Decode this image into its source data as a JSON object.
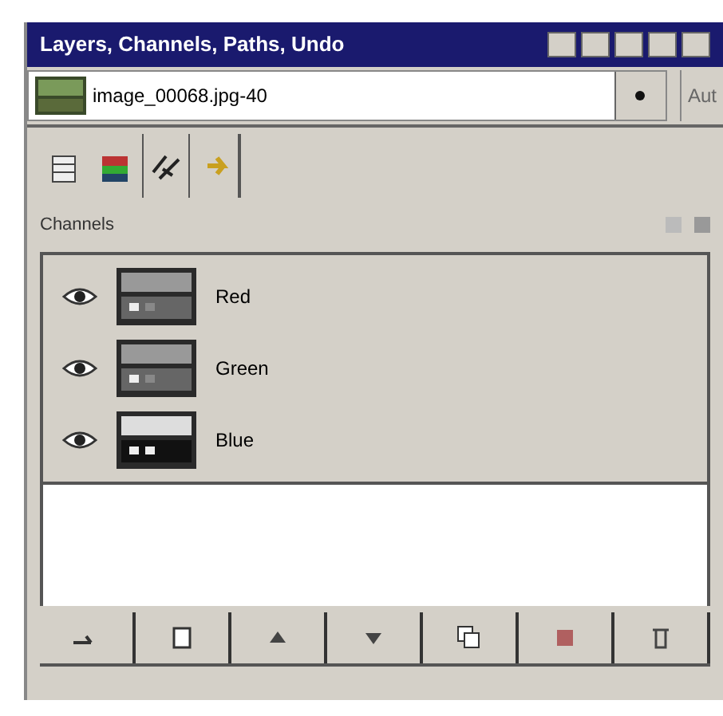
{
  "window": {
    "title": "Layers, Channels, Paths, Undo"
  },
  "image_menu": {
    "value": "image_00068.jpg-40"
  },
  "auto_button": {
    "label": "Aut"
  },
  "section": {
    "title": "Channels"
  },
  "channels": [
    {
      "name": "Red",
      "visible": true
    },
    {
      "name": "Green",
      "visible": true
    },
    {
      "name": "Blue",
      "visible": true
    }
  ]
}
